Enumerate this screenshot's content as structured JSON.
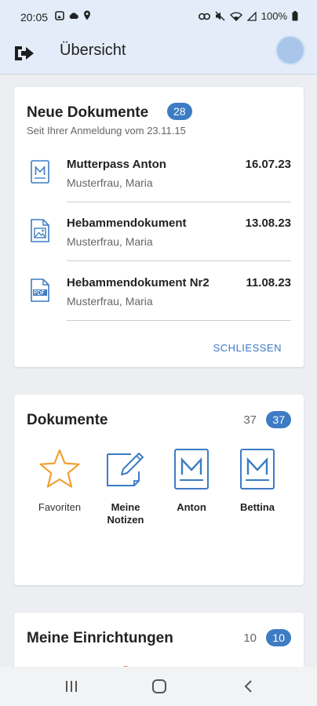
{
  "status_bar": {
    "time": "20:05",
    "battery": "100%"
  },
  "app_bar": {
    "title": "Übersicht"
  },
  "new_documents": {
    "title": "Neue Dokumente",
    "count": "28",
    "subtitle": "Seit Ihrer Anmeldung vom 23.11.15",
    "items": [
      {
        "name": "Mutterpass Anton",
        "owner": "Musterfrau, Maria",
        "date": "16.07.23",
        "icon": "mutterpass-doc-icon"
      },
      {
        "name": "Hebammendokument",
        "owner": "Musterfrau, Maria",
        "date": "13.08.23",
        "icon": "image-doc-icon"
      },
      {
        "name": "Hebammendokument Nr2",
        "owner": "Musterfrau, Maria",
        "date": "11.08.23",
        "icon": "pdf-doc-icon"
      }
    ],
    "close_label": "SCHLIESSEN"
  },
  "documents": {
    "title": "Dokumente",
    "count_plain": "37",
    "count_badge": "37",
    "tiles": [
      {
        "label": "Favoriten",
        "icon": "star-icon"
      },
      {
        "label": "Meine Notizen",
        "icon": "note-edit-icon"
      },
      {
        "label": "Anton",
        "icon": "mutterpass-icon"
      },
      {
        "label": "Bettina",
        "icon": "mutterpass-icon"
      }
    ]
  },
  "facilities": {
    "title": "Meine Einrichtungen",
    "count_plain": "10",
    "count_badge": "10"
  },
  "colors": {
    "accent": "#3d7cc4",
    "star": "#f0a030",
    "header_bg": "#e3ecf8"
  }
}
